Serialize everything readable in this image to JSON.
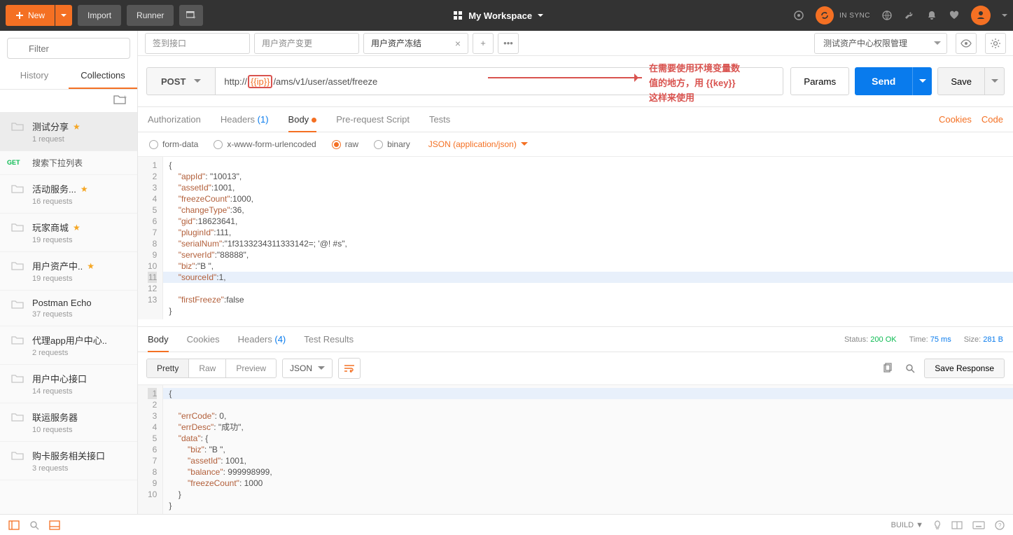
{
  "topbar": {
    "new": "New",
    "import": "Import",
    "runner": "Runner",
    "workspace": "My Workspace",
    "sync": "IN SYNC"
  },
  "sidebar": {
    "filter_ph": "Filter",
    "tab_history": "History",
    "tab_collections": "Collections",
    "collections": [
      {
        "name": "测试分享",
        "meta": "1 request",
        "star": true,
        "active": true
      },
      {
        "name": "活动服务...",
        "meta": "16 requests",
        "star": true
      },
      {
        "name": "玩家商城",
        "meta": "19 requests",
        "star": true
      },
      {
        "name": "用户资产中..",
        "meta": "19 requests",
        "star": true
      },
      {
        "name": "Postman Echo",
        "meta": "37 requests"
      },
      {
        "name": "代理app用户中心..",
        "meta": "2 requests"
      },
      {
        "name": "用户中心接口",
        "meta": "14 requests"
      },
      {
        "name": "联运服务器",
        "meta": "10 requests"
      },
      {
        "name": "购卡服务相关接口",
        "meta": "3 requests"
      }
    ],
    "req": {
      "method": "GET",
      "name": "搜索下拉列表"
    }
  },
  "tabs": [
    {
      "label": "签到接口"
    },
    {
      "label": "用户资产变更"
    },
    {
      "label": "用户资产冻结",
      "active": true,
      "closable": true
    }
  ],
  "env": {
    "name": "测试资产中心权限管理"
  },
  "request": {
    "method": "POST",
    "url_pre": "http://",
    "url_var": "{{ip}}",
    "url_post": "/ams/v1/user/asset/freeze",
    "params": "Params",
    "send": "Send",
    "save": "Save",
    "annotation_l1": "在需要使用环境变量数",
    "annotation_l2": "值的地方，用 {{key}}",
    "annotation_l3": "这样来使用"
  },
  "reqtabs": {
    "authorization": "Authorization",
    "headers": "Headers",
    "headers_count": "(1)",
    "body": "Body",
    "prerequest": "Pre-request Script",
    "tests": "Tests",
    "cookies": "Cookies",
    "code": "Code"
  },
  "bodyopts": {
    "formdata": "form-data",
    "urlencoded": "x-www-form-urlencoded",
    "raw": "raw",
    "binary": "binary",
    "jsonlabel": "JSON (application/json)"
  },
  "reqbody_lines": [
    "{",
    "    \"appId\": \"10013\",",
    "    \"assetId\":1001,",
    "    \"freezeCount\":1000,",
    "    \"changeType\":36,",
    "    \"gid\":18623641,",
    "    \"pluginId\":111,",
    "    \"serialNum\":\"1f3133234311333142=; '@! #s\",",
    "    \"serverId\":\"88888\",",
    "    \"biz\":\"B \",",
    "    \"sourceId\":1,",
    "    \"firstFreeze\":false",
    "}"
  ],
  "resptabs": {
    "body": "Body",
    "cookies": "Cookies",
    "headers": "Headers",
    "headers_count": "(4)",
    "testresults": "Test Results",
    "status_l": "Status:",
    "status_v": "200 OK",
    "time_l": "Time:",
    "time_v": "75 ms",
    "size_l": "Size:",
    "size_v": "281 B"
  },
  "resp_toolbar": {
    "pretty": "Pretty",
    "raw": "Raw",
    "preview": "Preview",
    "json": "JSON",
    "save": "Save Response"
  },
  "respbody_lines": [
    "{",
    "    \"errCode\": 0,",
    "    \"errDesc\": \"成功\",",
    "    \"data\": {",
    "        \"biz\": \"B \",",
    "        \"assetId\": 1001,",
    "        \"balance\": 999998999,",
    "        \"freezeCount\": 1000",
    "    }",
    "}"
  ],
  "statusbar": {
    "build": "BUILD"
  }
}
